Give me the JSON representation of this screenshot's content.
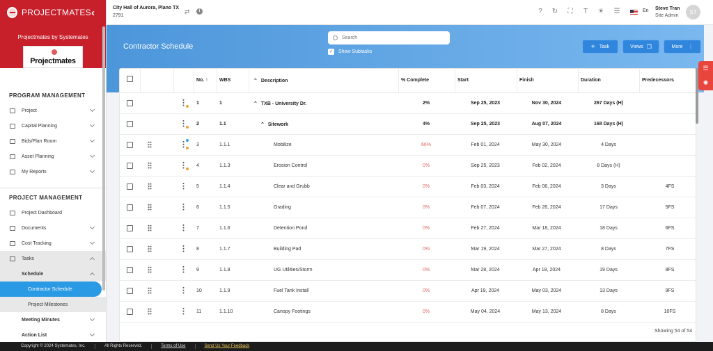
{
  "brand": {
    "name": "PROJECTMATES",
    "by": "Projectmates by Systemates",
    "logo_text": "Projectmates",
    "color": "#c8202b"
  },
  "sidebar": {
    "section1": "PROGRAM MANAGEMENT",
    "program_items": [
      {
        "label": "Project",
        "icon": "folder-tree-icon"
      },
      {
        "label": "Capital Planning",
        "icon": "dollar-icon"
      },
      {
        "label": "Bids/Plan Room",
        "icon": "gavel-icon"
      },
      {
        "label": "Asset Planning",
        "icon": "building-icon"
      },
      {
        "label": "My Reports",
        "icon": "report-icon"
      }
    ],
    "section2": "PROJECT MANAGEMENT",
    "pm_items": [
      {
        "label": "Project Dashboard",
        "icon": "dashboard-icon"
      },
      {
        "label": "Documents",
        "icon": "folder-icon"
      },
      {
        "label": "Cost Tracking",
        "icon": "wallet-icon"
      },
      {
        "label": "Tasks",
        "icon": "tasks-icon"
      }
    ],
    "schedule": "Schedule",
    "contractor_schedule": "Contractor Schedule",
    "project_milestones": "Project Milestones",
    "meeting_minutes": "Meeting Minutes",
    "action_list": "Action List",
    "active_color": "#2a9ae5"
  },
  "topbar": {
    "project": "City Hall of Aurora, Plano TX",
    "project_number": "2791",
    "language": "En",
    "user_name": "Steve Tran",
    "user_role": "Site Admin",
    "avatar_initials": "ST"
  },
  "header": {
    "title": "Contractor Schedule",
    "search_placeholder": "Search",
    "show_subtasks": "Show Subtasks",
    "task_btn": "Task",
    "views_btn": "Views",
    "more_btn": "More"
  },
  "table": {
    "columns": [
      "No.",
      "WBS",
      "Description",
      "% Complete",
      "Start",
      "Finish",
      "Duration",
      "Predecessors"
    ],
    "rows": [
      {
        "no": "1",
        "wbs": "1",
        "desc": "TXB - University Dr.",
        "pct": "2%",
        "start": "Sep 25, 2023",
        "finish": "Nov 30, 2024",
        "dur": "267 Days (H)",
        "pred": "",
        "level": 0,
        "bold": true,
        "caret": true,
        "drag": false,
        "dots": [
          "#f0a040"
        ]
      },
      {
        "no": "2",
        "wbs": "1.1",
        "desc": "Sitework",
        "pct": "4%",
        "start": "Sep 25, 2023",
        "finish": "Aug 07, 2024",
        "dur": "168 Days (H)",
        "pred": "",
        "level": 1,
        "bold": true,
        "caret": true,
        "drag": false,
        "dots": [
          "#f0a040"
        ]
      },
      {
        "no": "3",
        "wbs": "1.1.1",
        "desc": "Mobilize",
        "pct": "66%",
        "start": "Feb 01, 2024",
        "finish": "May 30, 2024",
        "dur": "4 Days",
        "pred": "",
        "level": 2,
        "bold": false,
        "caret": false,
        "drag": true,
        "dots": [
          "#3b9ae1",
          "#f0a040"
        ]
      },
      {
        "no": "4",
        "wbs": "1.1.3",
        "desc": "Erosion Control",
        "pct": "0%",
        "start": "Sep 25, 2023",
        "finish": "Feb 02, 2024",
        "dur": "8 Days (H)",
        "pred": "",
        "level": 2,
        "bold": false,
        "caret": false,
        "drag": true,
        "dots": [
          "#f0a040"
        ]
      },
      {
        "no": "5",
        "wbs": "1.1.4",
        "desc": "Clear and Grubb",
        "pct": "0%",
        "start": "Feb 03, 2024",
        "finish": "Feb 06, 2024",
        "dur": "3 Days",
        "pred": "4FS",
        "level": 2,
        "bold": false,
        "caret": false,
        "drag": true,
        "dots": []
      },
      {
        "no": "6",
        "wbs": "1.1.5",
        "desc": "Grading",
        "pct": "0%",
        "start": "Feb 07, 2024",
        "finish": "Feb 26, 2024",
        "dur": "17 Days",
        "pred": "5FS",
        "level": 2,
        "bold": false,
        "caret": false,
        "drag": true,
        "dots": []
      },
      {
        "no": "7",
        "wbs": "1.1.6",
        "desc": "Detention Pond",
        "pct": "0%",
        "start": "Feb 27, 2024",
        "finish": "Mar 18, 2024",
        "dur": "18 Days",
        "pred": "6FS",
        "level": 2,
        "bold": false,
        "caret": false,
        "drag": true,
        "dots": []
      },
      {
        "no": "8",
        "wbs": "1.1.7",
        "desc": "Building Pad",
        "pct": "0%",
        "start": "Mar 19, 2024",
        "finish": "Mar 27, 2024",
        "dur": "8 Days",
        "pred": "7FS",
        "level": 2,
        "bold": false,
        "caret": false,
        "drag": true,
        "dots": []
      },
      {
        "no": "9",
        "wbs": "1.1.8",
        "desc": "UG Utilities/Storm",
        "pct": "0%",
        "start": "Mar 28, 2024",
        "finish": "Apr 18, 2024",
        "dur": "19 Days",
        "pred": "8FS",
        "level": 2,
        "bold": false,
        "caret": false,
        "drag": true,
        "dots": []
      },
      {
        "no": "10",
        "wbs": "1.1.9",
        "desc": "Fuel Tank Install",
        "pct": "0%",
        "start": "Apr 19, 2024",
        "finish": "May 03, 2024",
        "dur": "13 Days",
        "pred": "9FS",
        "level": 2,
        "bold": false,
        "caret": false,
        "drag": true,
        "dots": []
      },
      {
        "no": "11",
        "wbs": "1.1.10",
        "desc": "Canopy Footings",
        "pct": "0%",
        "start": "May 04, 2024",
        "finish": "May 13, 2024",
        "dur": "8 Days",
        "pred": "10FS",
        "level": 2,
        "bold": false,
        "caret": false,
        "drag": true,
        "dots": []
      }
    ],
    "showing": "Showing 54 of 54"
  },
  "footer": {
    "copyright": "Copyright © 2024 Systemates, Inc.",
    "rights": "All Rights Reserved.",
    "terms": "Terms of Use",
    "feedback": "Send Us Your Feedback"
  }
}
